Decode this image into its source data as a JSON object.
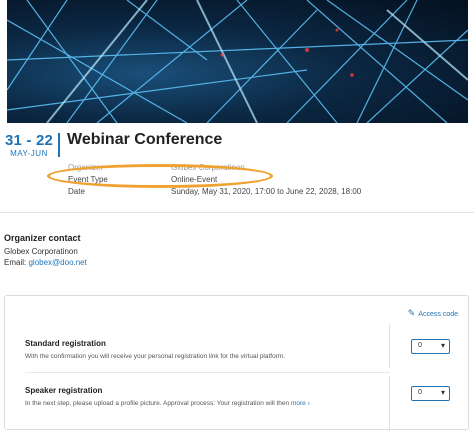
{
  "event": {
    "date_range": "31 - 22",
    "months": "MAY-JUN",
    "title": "Webinar Conference",
    "organizer_label": "Organizer",
    "organizer_value": "Globex Corporatinon",
    "event_type_label": "Event Type",
    "event_type_value": "Online-Event",
    "date_label": "Date",
    "date_value": "Sunday, May 31, 2020, 17:00 to June 22, 2028, 18:00"
  },
  "organizer_contact": {
    "heading": "Organizer contact",
    "name": "Globex Corporatinon",
    "email_label": "Email:",
    "email": "globex@doo.net"
  },
  "registration": {
    "access_code_label": "Access code",
    "options": [
      {
        "title": "Standard registration",
        "description": "With the confirmation you will receive your personal registration link for the virtual platform.",
        "quantity": "0"
      },
      {
        "title": "Speaker registration",
        "description": "In the next step, please upload a profile picture. Approval process: Your registration will then",
        "more_label": "more ›",
        "quantity": "0"
      }
    ]
  },
  "colors": {
    "accent": "#1f74b8",
    "highlight_oval": "#f0a230"
  },
  "icons": [
    "pencil-icon",
    "chevron-down-icon"
  ]
}
